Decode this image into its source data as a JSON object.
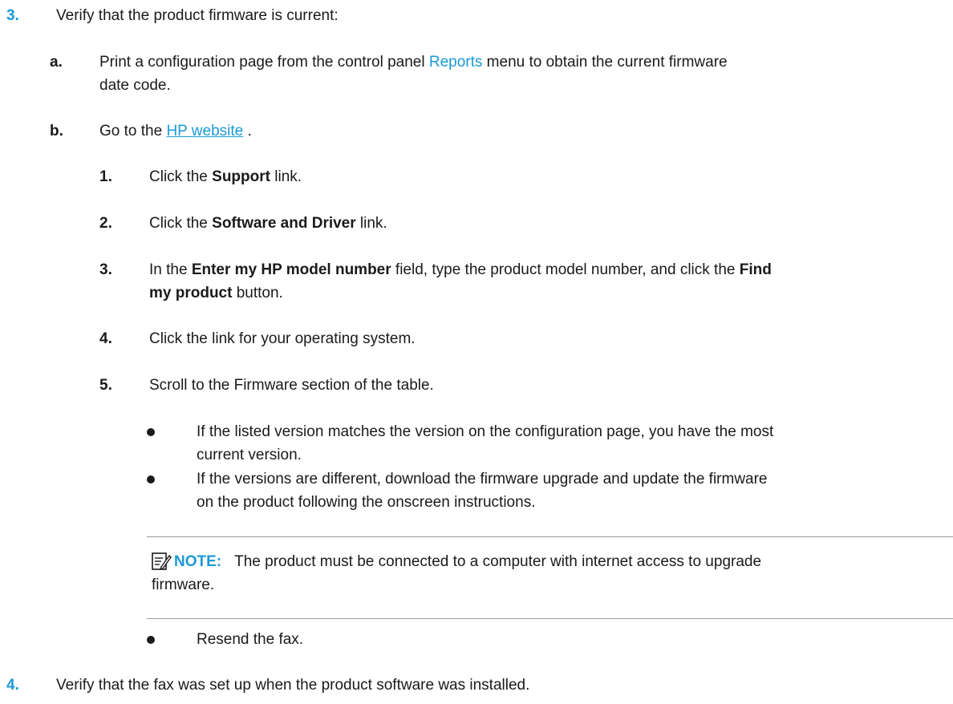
{
  "step3": {
    "num": "3.",
    "text": "Verify that the product firmware is current:"
  },
  "step3a": {
    "letter": "a.",
    "before": "Print a configuration page from the control panel ",
    "link": "Reports",
    "after": " menu to obtain the current firmware",
    "line2": "date code."
  },
  "step3b": {
    "letter": "b.",
    "before": "Go to the ",
    "link": "HP website",
    "after": " ."
  },
  "sub1": {
    "num": "1.",
    "before": "Click the ",
    "bold": "Support",
    "after": " link."
  },
  "sub2": {
    "num": "2.",
    "before": "Click the ",
    "bold": "Software and Driver",
    "after": " link."
  },
  "sub3": {
    "num": "3.",
    "before": "In the ",
    "bold1": "Enter my HP model number",
    "mid": " field, type the product model number, and click the ",
    "bold2a": "Find",
    "bold2b": "my product",
    "after": " button."
  },
  "sub4": {
    "num": "4.",
    "text": "Click the link for your operating system."
  },
  "sub5": {
    "num": "5.",
    "text": "Scroll to the Firmware section of the table."
  },
  "bullet1": {
    "line1": "If the listed version matches the version on the configuration page, you have the most",
    "line2": "current version."
  },
  "bullet2": {
    "line1": "If the versions are different, download the firmware upgrade and update the firmware",
    "line2": "on the product following the onscreen instructions."
  },
  "note": {
    "label": "NOTE:",
    "line1": "The product must be connected to a computer with internet access to upgrade",
    "line2": "firmware."
  },
  "bullet3": {
    "text": "Resend the fax."
  },
  "step4": {
    "num": "4.",
    "text": "Verify that the fax was set up when the product software was installed."
  }
}
